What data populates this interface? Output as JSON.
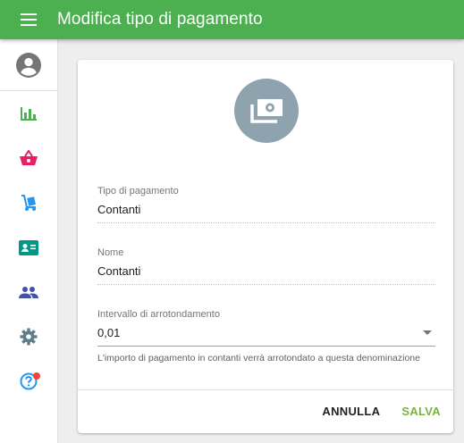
{
  "header": {
    "title": "Modifica tipo di pagamento"
  },
  "sidebar": {
    "items": [
      {
        "icon": "bar-chart-icon",
        "color": "#4caf50"
      },
      {
        "icon": "shopping-basket-icon",
        "color": "#e91e63"
      },
      {
        "icon": "hand-truck-icon",
        "color": "#2196f3"
      },
      {
        "icon": "contact-card-icon",
        "color": "#009688"
      },
      {
        "icon": "people-icon",
        "color": "#3f51b5"
      },
      {
        "icon": "gear-icon",
        "color": "#607d8b"
      },
      {
        "icon": "help-icon",
        "color": "#2196f3",
        "notification": true
      }
    ]
  },
  "form": {
    "hero_icon": "money-icon",
    "payment_type": {
      "label": "Tipo di pagamento",
      "value": "Contanti"
    },
    "name": {
      "label": "Nome",
      "value": "Contanti"
    },
    "rounding": {
      "label": "Intervallo di arrotondamento",
      "value": "0,01",
      "hint": "L'importo di pagamento in contanti verrà arrotondato a questa denominazione"
    }
  },
  "actions": {
    "cancel_label": "ANNULLA",
    "save_label": "SALVA"
  },
  "colors": {
    "primary": "#4caf50",
    "save": "#7cb342",
    "hero_circle": "#8fa3ae",
    "notification": "#f44336"
  }
}
